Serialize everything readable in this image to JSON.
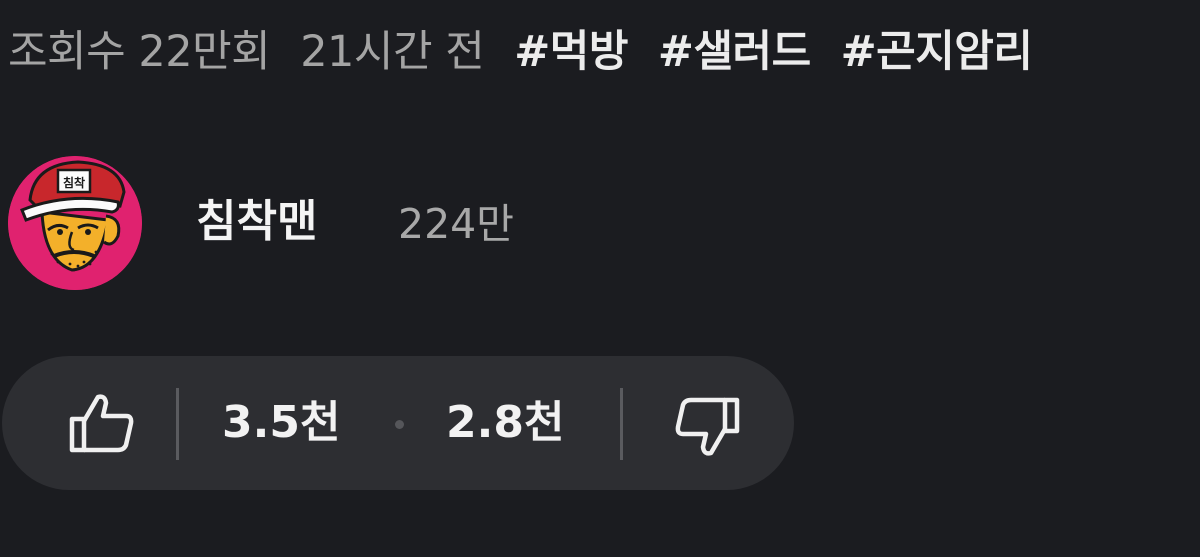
{
  "meta": {
    "views": "조회수 22만회",
    "time": "21시간 전",
    "hashtags": [
      "#먹방",
      "#샐러드",
      "#곤지암리"
    ]
  },
  "channel": {
    "name": "침착맨",
    "subscribers": "224만",
    "avatar_cap_text": "침착",
    "avatar_icon": "cartoon-face-avatar",
    "avatar_bg": "#e0226f"
  },
  "reactions": {
    "likes": "3.5천",
    "dislikes": "2.8천",
    "like_icon": "thumbs-up-icon",
    "dislike_icon": "thumbs-down-icon"
  },
  "colors": {
    "background": "#1b1c20",
    "pill": "#2d2e32",
    "primary_text": "#f2f2f2",
    "secondary_text": "#a4a4a4"
  }
}
